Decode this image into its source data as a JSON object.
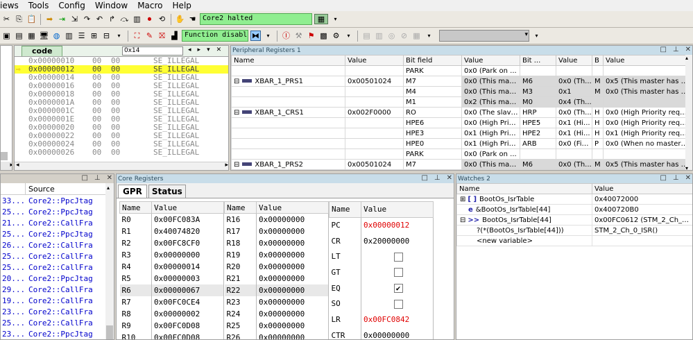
{
  "menu": [
    "iews",
    "Tools",
    "Config",
    "Window",
    "Macro",
    "Help"
  ],
  "toolbar1": {
    "status": "Core2 halted"
  },
  "toolbar2": {
    "dropdown": "Function disabl"
  },
  "code_panel": {
    "tab": "code",
    "address": "0x14",
    "nav": [
      "◂",
      "▸",
      "▾",
      "✕"
    ],
    "lines": [
      {
        "addr": "0x00000010",
        "b1": "00",
        "b2": "00",
        "instr": "SE_ILLEGAL",
        "highlight": false
      },
      {
        "addr": "0x00000012",
        "b1": "00",
        "b2": "00",
        "instr": "SE_ILLEGAL",
        "highlight": true
      },
      {
        "addr": "0x00000014",
        "b1": "00",
        "b2": "00",
        "instr": "SE_ILLEGAL",
        "highlight": false
      },
      {
        "addr": "0x00000016",
        "b1": "00",
        "b2": "00",
        "instr": "SE_ILLEGAL",
        "highlight": false
      },
      {
        "addr": "0x00000018",
        "b1": "00",
        "b2": "00",
        "instr": "SE_ILLEGAL",
        "highlight": false
      },
      {
        "addr": "0x0000001A",
        "b1": "00",
        "b2": "00",
        "instr": "SE_ILLEGAL",
        "highlight": false
      },
      {
        "addr": "0x0000001C",
        "b1": "00",
        "b2": "00",
        "instr": "SE_ILLEGAL",
        "highlight": false
      },
      {
        "addr": "0x0000001E",
        "b1": "00",
        "b2": "00",
        "instr": "SE_ILLEGAL",
        "highlight": false
      },
      {
        "addr": "0x00000020",
        "b1": "00",
        "b2": "00",
        "instr": "SE_ILLEGAL",
        "highlight": false
      },
      {
        "addr": "0x00000022",
        "b1": "00",
        "b2": "00",
        "instr": "SE_ILLEGAL",
        "highlight": false
      },
      {
        "addr": "0x00000024",
        "b1": "00",
        "b2": "00",
        "instr": "SE_ILLEGAL",
        "highlight": false
      },
      {
        "addr": "0x00000026",
        "b1": "00",
        "b2": "00",
        "instr": "SE_ILLEGAL",
        "highlight": false
      }
    ]
  },
  "periph": {
    "title": "Peripheral Registers 1",
    "headers": [
      "Name",
      "Value",
      "Bit field",
      "Value",
      "Bit ...",
      "Value",
      "B",
      "Value"
    ],
    "rows": [
      {
        "expander": "",
        "name": "",
        "value": "",
        "bf": "PARK",
        "bv": "0x0 (Park on ...",
        "bf2": "",
        "bv2": "",
        "b": "",
        "v3": "",
        "gray": false
      },
      {
        "expander": "⊟",
        "name": "XBAR_1_PRS1",
        "value": "0x00501024",
        "bf": "M7",
        "bv": "0x0 (This mast...",
        "bf2": "M6",
        "bv2": "0x0 (Th...",
        "b": "M",
        "v3": "0x5 (This master has l...",
        "gray": true
      },
      {
        "expander": "",
        "name": "",
        "value": "",
        "bf": "M4",
        "bv": "0x0 (This mast...",
        "bf2": "M3",
        "bv2": "0x1",
        "b": "M",
        "v3": "0x0 (This master has l...",
        "gray": true
      },
      {
        "expander": "",
        "name": "",
        "value": "",
        "bf": "M1",
        "bv": "0x2 (This mast...",
        "bf2": "M0",
        "bv2": "0x4 (Th...",
        "b": "",
        "v3": "",
        "gray": true
      },
      {
        "expander": "⊟",
        "name": "XBAR_1_CRS1",
        "value": "0x002F0000",
        "bf": "RO",
        "bv": "0x0 (The slave...",
        "bf2": "HRP",
        "bv2": "0x0 (Th...",
        "b": "H",
        "v3": "0x0 (High Priority requ...",
        "gray": false
      },
      {
        "expander": "",
        "name": "",
        "value": "",
        "bf": "HPE6",
        "bv": "0x0 (High Prior...",
        "bf2": "HPE5",
        "bv2": "0x1 (Hi...",
        "b": "H",
        "v3": "0x0 (High Priority requ...",
        "gray": false
      },
      {
        "expander": "",
        "name": "",
        "value": "",
        "bf": "HPE3",
        "bv": "0x1 (High Prior...",
        "bf2": "HPE2",
        "bv2": "0x1 (Hi...",
        "b": "H",
        "v3": "0x1 (High Priority requ...",
        "gray": false
      },
      {
        "expander": "",
        "name": "",
        "value": "",
        "bf": "HPE0",
        "bv": "0x1 (High Prior...",
        "bf2": "ARB",
        "bv2": "0x0 (Fix...",
        "b": "P",
        "v3": "0x0 (When no master ...",
        "gray": false
      },
      {
        "expander": "",
        "name": "",
        "value": "",
        "bf": "PARK",
        "bv": "0x0 (Park on ...",
        "bf2": "",
        "bv2": "",
        "b": "",
        "v3": "",
        "gray": false
      },
      {
        "expander": "⊟",
        "name": "XBAR_1_PRS2",
        "value": "0x00501024",
        "bf": "M7",
        "bv": "0x0 (This mast...",
        "bf2": "M6",
        "bv2": "0x0 (Th...",
        "b": "M",
        "v3": "0x5 (This master has l...",
        "gray": true
      }
    ]
  },
  "source": {
    "header": "Source",
    "rows": [
      {
        "c": "33...",
        "s": "Core2::PpcJtag"
      },
      {
        "c": "25...",
        "s": "Core2::PpcJtag"
      },
      {
        "c": "21...",
        "s": "Core2::CallFra"
      },
      {
        "c": "25...",
        "s": "Core2::PpcJtag"
      },
      {
        "c": "26...",
        "s": "Core2::CallFra"
      },
      {
        "c": "25...",
        "s": "Core2::CallFra"
      },
      {
        "c": "25...",
        "s": "Core2::CallFra"
      },
      {
        "c": "20...",
        "s": "Core2::PpcJtag"
      },
      {
        "c": "29...",
        "s": "Core2::CallFra"
      },
      {
        "c": "19...",
        "s": "Core2::CallFra"
      },
      {
        "c": "23...",
        "s": "Core2::CallFra"
      },
      {
        "c": "25...",
        "s": "Core2::CallFra"
      },
      {
        "c": "23...",
        "s": "Core2::PpcJtag"
      }
    ]
  },
  "core": {
    "title": "Core Registers",
    "tabs": [
      "GPR",
      "Status"
    ],
    "col_name": "Name",
    "col_value": "Value",
    "gpr1": [
      [
        "R0",
        "0x00FC083A"
      ],
      [
        "R1",
        "0x40074820"
      ],
      [
        "R2",
        "0x00FC8CF0"
      ],
      [
        "R3",
        "0x00000000"
      ],
      [
        "R4",
        "0x00000014"
      ],
      [
        "R5",
        "0x00000003"
      ],
      [
        "R6",
        "0x00000067"
      ],
      [
        "R7",
        "0x00FC0CE4"
      ],
      [
        "R8",
        "0x00000002"
      ],
      [
        "R9",
        "0x00FC0D08"
      ],
      [
        "R10",
        "0x00FC0D08"
      ]
    ],
    "gpr2": [
      [
        "R16",
        "0x00000000"
      ],
      [
        "R17",
        "0x00000000"
      ],
      [
        "R18",
        "0x00000000"
      ],
      [
        "R19",
        "0x00000000"
      ],
      [
        "R20",
        "0x00000000"
      ],
      [
        "R21",
        "0x00000000"
      ],
      [
        "R22",
        "0x00000000"
      ],
      [
        "R23",
        "0x00000000"
      ],
      [
        "R24",
        "0x00000000"
      ],
      [
        "R25",
        "0x00000000"
      ],
      [
        "R26",
        "0x00000000"
      ]
    ],
    "special": [
      {
        "n": "PC",
        "v": "0x00000012",
        "red": true,
        "chk": null
      },
      {
        "n": "CR",
        "v": "0x20000000",
        "red": false,
        "chk": null
      },
      {
        "n": "LT",
        "v": "",
        "red": false,
        "chk": false
      },
      {
        "n": "GT",
        "v": "",
        "red": false,
        "chk": false
      },
      {
        "n": "EQ",
        "v": "",
        "red": false,
        "chk": true
      },
      {
        "n": "SO",
        "v": "",
        "red": false,
        "chk": false
      },
      {
        "n": "LR",
        "v": "0x00FC0842",
        "red": true,
        "chk": null
      },
      {
        "n": "CTR",
        "v": "0x00000000",
        "red": false,
        "chk": null
      }
    ]
  },
  "watches": {
    "title": "Watches 2",
    "col_name": "Name",
    "col_value": "Value",
    "rows": [
      {
        "exp": "⊞",
        "icon": "[ ]",
        "name": "BootOs_IsrTable",
        "value": "0x40072000",
        "indent": 0
      },
      {
        "exp": "",
        "icon": "e",
        "name": "&BootOs_IsrTable[44]",
        "value": "0x400720B0",
        "indent": 1
      },
      {
        "exp": "⊟",
        "icon": ">>",
        "name": "BootOs_IsrTable[44]",
        "value": "0x00FC0612 (STM_2_Ch_0...",
        "indent": 0
      },
      {
        "exp": "",
        "icon": "",
        "name": "?(*(BootOs_IsrTable[44]))",
        "value": "STM_2_Ch_0_ISR()",
        "indent": 2
      },
      {
        "exp": "",
        "icon": "",
        "name": "<new variable>",
        "value": "",
        "indent": 2
      }
    ]
  },
  "colors": {
    "status_green": "#90ee90",
    "highlight": "#ffff33",
    "panel_title": "#c8dde9",
    "red_value": "#e00000",
    "source_blue": "#0000cc"
  }
}
